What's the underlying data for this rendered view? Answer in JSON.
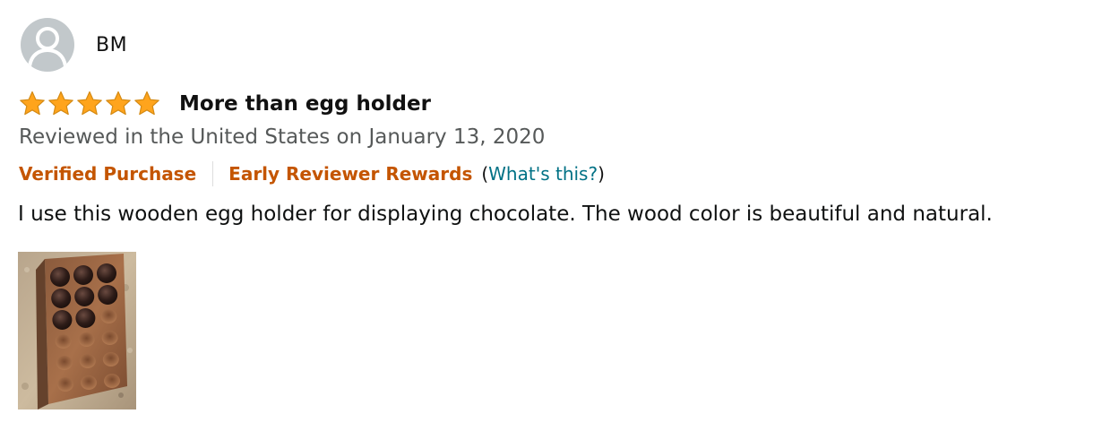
{
  "profile": {
    "name": "BM",
    "avatar_icon": "user-silhouette-icon"
  },
  "rating": {
    "stars": 5,
    "max_stars": 5,
    "star_color": "#ffa41c"
  },
  "review": {
    "title": "More than egg holder",
    "date": "Reviewed in the United States on January 13, 2020",
    "verified_label": "Verified Purchase",
    "early_reviewer_label": "Early Reviewer Rewards",
    "whats_this_open": "(",
    "whats_this_label": "What's this?",
    "whats_this_close": ")",
    "body": "I use this wooden egg holder for displaying chocolate. The wood color is beautiful and natural."
  },
  "colors": {
    "badge": "#c45500",
    "link": "#007185",
    "muted": "#565959",
    "text": "#0f1111"
  },
  "image": {
    "icon": "review-photo-thumbnail"
  }
}
